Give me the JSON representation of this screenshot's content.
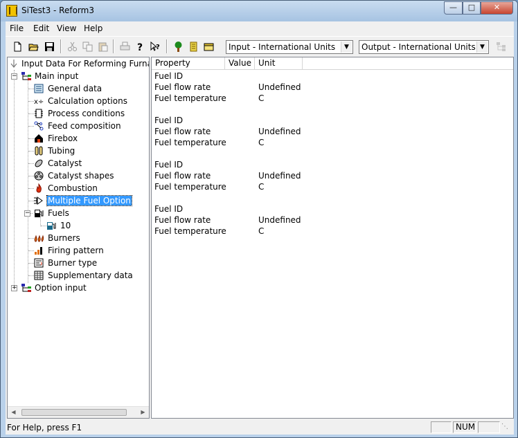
{
  "window": {
    "title": "SiTest3 - Reform3"
  },
  "menu": [
    "File",
    "Edit",
    "View",
    "Help"
  ],
  "toolbar": {
    "input_units": "Input - International Units",
    "output_units": "Output - International Units"
  },
  "tree": {
    "root": "Input Data For Reforming Furnace",
    "main_input": "Main input",
    "items": {
      "general_data": "General data",
      "calculation_options": "Calculation options",
      "process_conditions": "Process conditions",
      "feed_composition": "Feed composition",
      "firebox": "Firebox",
      "tubing": "Tubing",
      "catalyst": "Catalyst",
      "catalyst_shapes": "Catalyst shapes",
      "combustion": "Combustion",
      "multiple_fuel_option": "Multiple Fuel Option",
      "fuels": "Fuels",
      "fuel_10": "10",
      "burners": "Burners",
      "firing_pattern": "Firing pattern",
      "burner_type": "Burner type",
      "supplementary_data": "Supplementary data"
    },
    "option_input": "Option input"
  },
  "grid": {
    "headers": [
      "Property",
      "Value",
      "Unit"
    ],
    "groups": [
      {
        "fuel_id": "Fuel ID",
        "flow_rate": "Fuel flow rate",
        "flow_unit": "Undefined",
        "temperature": "Fuel temperature",
        "temp_unit": "C"
      },
      {
        "fuel_id": "Fuel ID",
        "flow_rate": "Fuel flow rate",
        "flow_unit": "Undefined",
        "temperature": "Fuel temperature",
        "temp_unit": "C"
      },
      {
        "fuel_id": "Fuel ID",
        "flow_rate": "Fuel flow rate",
        "flow_unit": "Undefined",
        "temperature": "Fuel temperature",
        "temp_unit": "C"
      },
      {
        "fuel_id": "Fuel ID",
        "flow_rate": "Fuel flow rate",
        "flow_unit": "Undefined",
        "temperature": "Fuel temperature",
        "temp_unit": "C"
      }
    ]
  },
  "status": {
    "help": "For Help, press F1",
    "num": "NUM"
  }
}
